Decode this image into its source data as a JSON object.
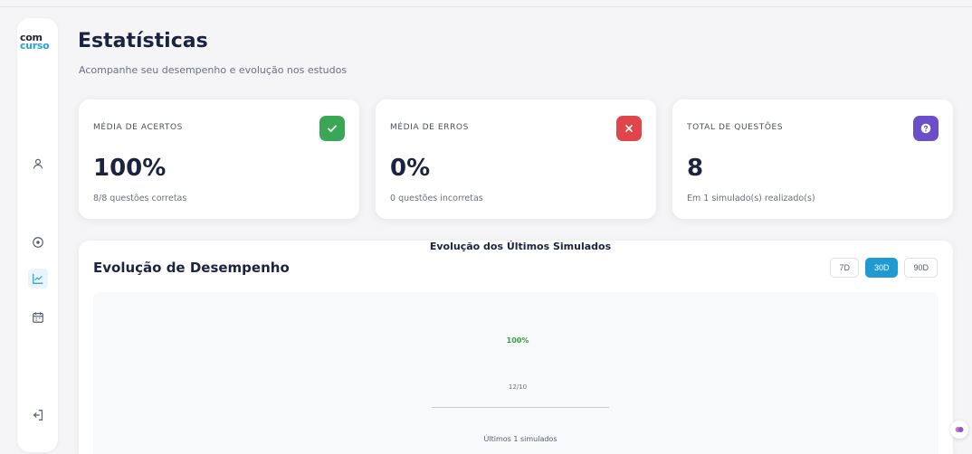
{
  "brand": {
    "line1": "com",
    "line2": "curso"
  },
  "header": {
    "title": "Estatísticas",
    "subtitle": "Acompanhe seu desempenho e evolução nos estudos"
  },
  "sidebar": {
    "items": [
      {
        "icon": "user-icon"
      },
      {
        "icon": "compass-icon"
      },
      {
        "icon": "chart-line-icon",
        "active": true
      },
      {
        "icon": "calendar-icon"
      },
      {
        "icon": "logout-icon"
      }
    ]
  },
  "cards": [
    {
      "label": "MÉDIA DE ACERTOS",
      "value": "100%",
      "sub": "8/8 questões corretas",
      "icon": "check-icon",
      "color": "#3aa757"
    },
    {
      "label": "MÉDIA DE ERROS",
      "value": "0%",
      "sub": "0 questões incorretas",
      "icon": "close-icon",
      "color": "#e0454b"
    },
    {
      "label": "TOTAL DE QUESTÕES",
      "value": "8",
      "sub": "Em 1 simulado(s) realizado(s)",
      "icon": "question-icon",
      "color": "#6a4fc9"
    }
  ],
  "performance": {
    "title": "Evolução de Desempenho",
    "periods": [
      "7D",
      "30D",
      "90D"
    ],
    "selected_period": "30D"
  },
  "chart_data": {
    "type": "bar",
    "title": "Evolução dos Últimos Simulados",
    "categories": [
      "12/10"
    ],
    "values": [
      100
    ],
    "data_labels": [
      "100%"
    ],
    "xlabel": "Últimos 1 simulados",
    "bar_color": "#3a9a3f"
  },
  "colors": {
    "accent": "#1f9bd1",
    "brand": "#2aa1d3"
  }
}
